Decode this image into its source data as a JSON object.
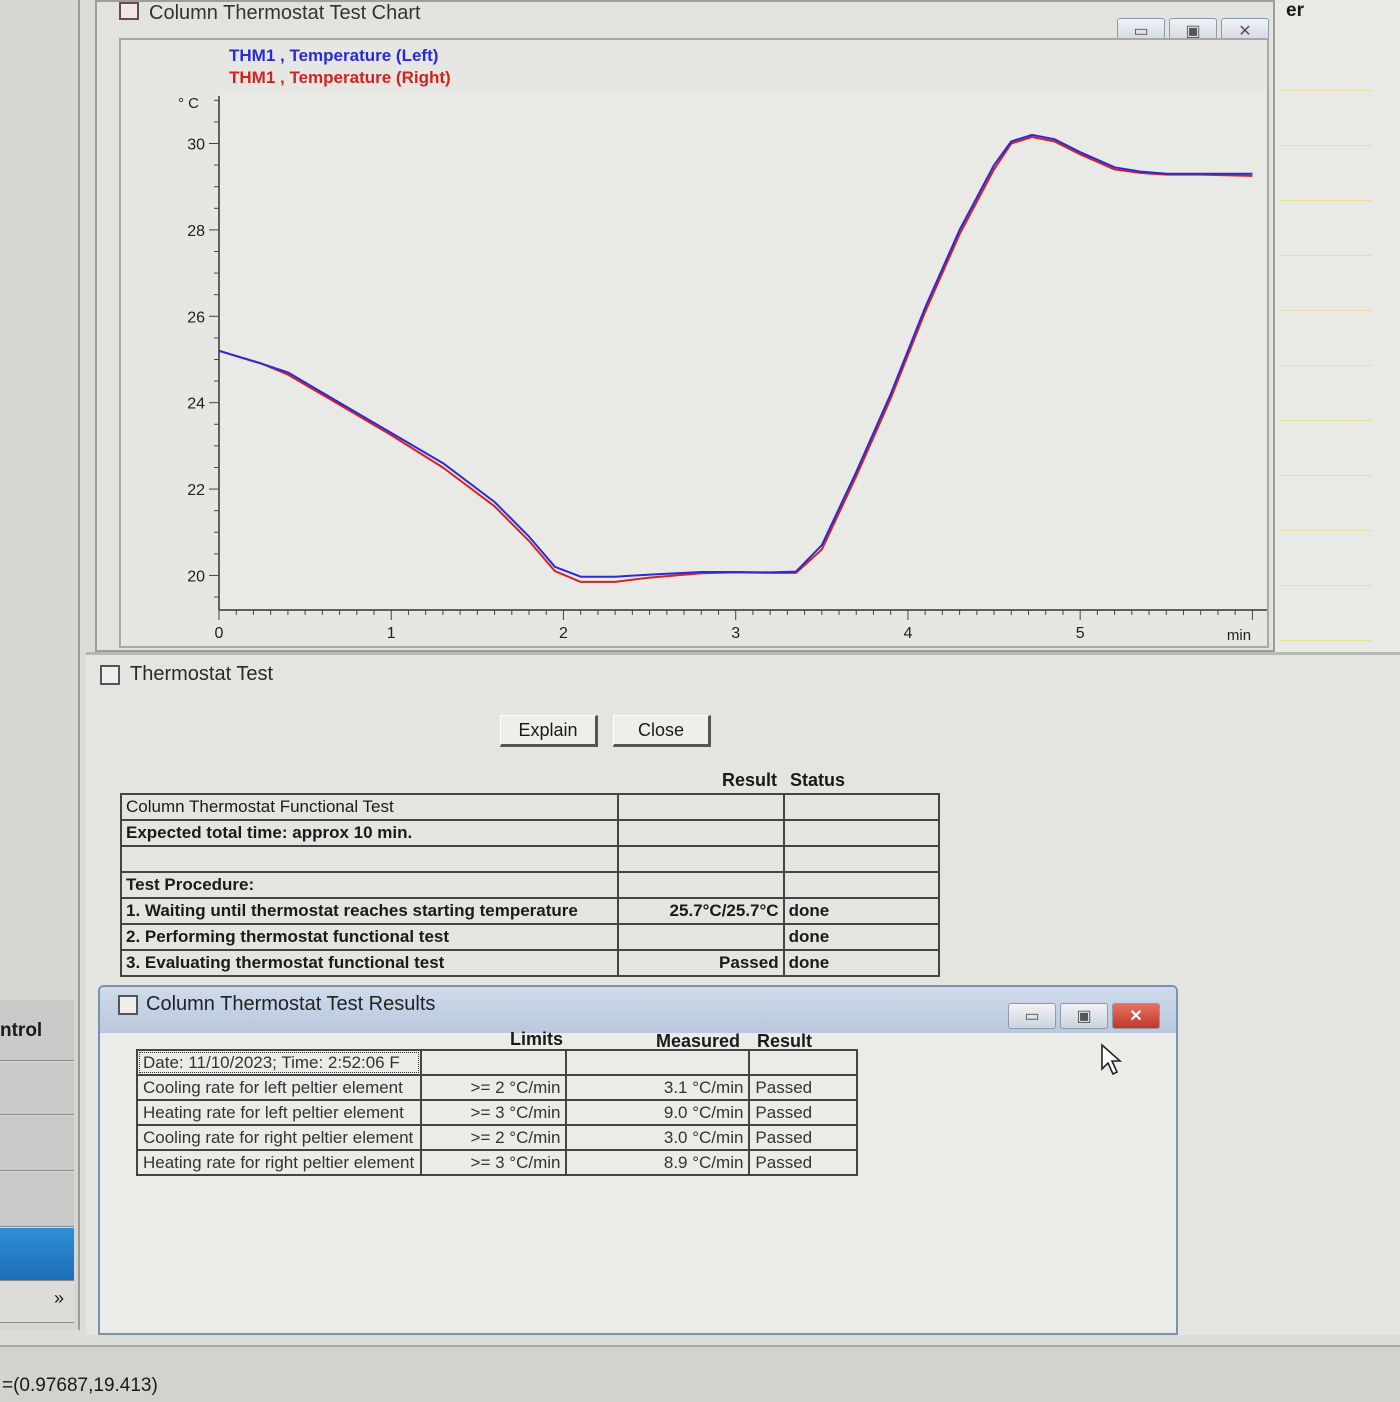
{
  "background": {
    "left_label": "ntrol",
    "right_label": "er",
    "expand_glyph": "»"
  },
  "status_bar": {
    "coordinates": "=(0.97687,19.413)"
  },
  "chart_window": {
    "title": "Column Thermostat Test Chart",
    "legend": [
      {
        "channel": "THM1",
        "sep": ",",
        "label": "Temperature (Left)",
        "color": "#2a2ad8"
      },
      {
        "channel": "THM1",
        "sep": ",",
        "label": "Temperature (Right)",
        "color": "#d42222"
      }
    ]
  },
  "chart_data": {
    "type": "line",
    "ylabel": "° C",
    "xlabel": "min",
    "ylim": [
      19.2,
      31.1
    ],
    "xlim": [
      0,
      6.05
    ],
    "x_ticks": [
      0,
      1,
      2,
      3,
      4,
      5
    ],
    "y_ticks": [
      20,
      22,
      24,
      26,
      28,
      30
    ],
    "series": [
      {
        "name": "THM1 , Temperature (Left)",
        "color": "#2a2ad8",
        "points": [
          [
            0,
            25.2
          ],
          [
            0.25,
            24.9
          ],
          [
            0.4,
            24.7
          ],
          [
            0.7,
            24.0
          ],
          [
            1.0,
            23.3
          ],
          [
            1.3,
            22.6
          ],
          [
            1.6,
            21.7
          ],
          [
            1.8,
            20.9
          ],
          [
            1.95,
            20.2
          ],
          [
            2.1,
            19.97
          ],
          [
            2.3,
            19.97
          ],
          [
            2.5,
            20.02
          ],
          [
            2.8,
            20.08
          ],
          [
            3.0,
            20.08
          ],
          [
            3.2,
            20.07
          ],
          [
            3.35,
            20.09
          ],
          [
            3.5,
            20.7
          ],
          [
            3.7,
            22.4
          ],
          [
            3.9,
            24.2
          ],
          [
            4.1,
            26.2
          ],
          [
            4.3,
            28.0
          ],
          [
            4.5,
            29.5
          ],
          [
            4.6,
            30.05
          ],
          [
            4.72,
            30.2
          ],
          [
            4.85,
            30.1
          ],
          [
            5.0,
            29.8
          ],
          [
            5.2,
            29.45
          ],
          [
            5.35,
            29.35
          ],
          [
            5.5,
            29.3
          ],
          [
            5.7,
            29.3
          ],
          [
            6.0,
            29.3
          ]
        ]
      },
      {
        "name": "THM1 , Temperature (Right)",
        "color": "#d42222",
        "points": [
          [
            0,
            25.2
          ],
          [
            0.25,
            24.9
          ],
          [
            0.4,
            24.65
          ],
          [
            0.7,
            23.95
          ],
          [
            1.0,
            23.25
          ],
          [
            1.3,
            22.5
          ],
          [
            1.6,
            21.6
          ],
          [
            1.8,
            20.8
          ],
          [
            1.95,
            20.1
          ],
          [
            2.1,
            19.85
          ],
          [
            2.3,
            19.85
          ],
          [
            2.5,
            19.95
          ],
          [
            2.8,
            20.05
          ],
          [
            3.0,
            20.07
          ],
          [
            3.2,
            20.06
          ],
          [
            3.35,
            20.06
          ],
          [
            3.5,
            20.6
          ],
          [
            3.7,
            22.3
          ],
          [
            3.9,
            24.1
          ],
          [
            4.1,
            26.1
          ],
          [
            4.3,
            27.9
          ],
          [
            4.5,
            29.4
          ],
          [
            4.6,
            30.0
          ],
          [
            4.72,
            30.15
          ],
          [
            4.85,
            30.05
          ],
          [
            5.0,
            29.75
          ],
          [
            5.2,
            29.4
          ],
          [
            5.35,
            29.32
          ],
          [
            5.5,
            29.28
          ],
          [
            5.7,
            29.28
          ],
          [
            6.0,
            29.25
          ]
        ]
      }
    ]
  },
  "test_window": {
    "title": "Thermostat Test",
    "buttons": {
      "explain": "Explain",
      "close": "Close"
    },
    "headers": {
      "result": "Result",
      "status": "Status"
    },
    "rows": [
      {
        "label": "Column Thermostat Functional Test",
        "result": "",
        "status": "",
        "bold": false
      },
      {
        "label": "Expected total time: approx 10 min.",
        "result": "",
        "status": "",
        "bold": true
      },
      {
        "label": "",
        "result": "",
        "status": "",
        "bold": false
      },
      {
        "label": "Test Procedure:",
        "result": "",
        "status": "",
        "bold": true
      },
      {
        "label": "1. Waiting until thermostat reaches starting temperature",
        "result": "25.7°C/25.7°C",
        "status": "done",
        "bold": true
      },
      {
        "label": "2. Performing thermostat functional test",
        "result": "",
        "status": "done",
        "bold": true
      },
      {
        "label": "3. Evaluating thermostat functional test",
        "result": "Passed",
        "status": "done",
        "bold": true
      }
    ]
  },
  "results_window": {
    "title": "Column Thermostat Test Results",
    "headers": {
      "limits": "Limits",
      "measured": "Measured",
      "result": "Result"
    },
    "date_row": "Date: 11/10/2023;  Time: 2:52:06 F",
    "rows": [
      {
        "label": "Cooling rate for left peltier element",
        "limit": ">= 2 °C/min",
        "measured": "3.1 °C/min",
        "result": "Passed"
      },
      {
        "label": "Heating rate for left peltier element",
        "limit": ">= 3 °C/min",
        "measured": "9.0 °C/min",
        "result": "Passed"
      },
      {
        "label": "Cooling rate for right peltier element",
        "limit": ">= 2 °C/min",
        "measured": "3.0 °C/min",
        "result": "Passed"
      },
      {
        "label": "Heating rate for right peltier element",
        "limit": ">= 3 °C/min",
        "measured": "8.9 °C/min",
        "result": "Passed"
      }
    ]
  }
}
